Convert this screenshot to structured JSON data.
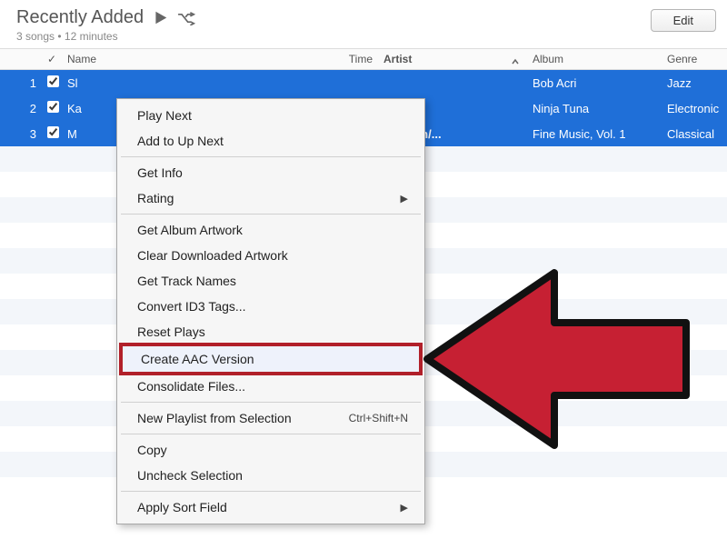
{
  "header": {
    "title": "Recently Added",
    "subtitle": "3 songs • 12 minutes",
    "edit_label": "Edit"
  },
  "columns": {
    "check": "✓",
    "name": "Name",
    "time": "Time",
    "artist": "Artist",
    "album": "Album",
    "genre": "Genre"
  },
  "rows": [
    {
      "num": "1",
      "checked": true,
      "name": "Sl",
      "time": "",
      "artist": "",
      "album": "Bob Acri",
      "genre": "Jazz",
      "selected": true
    },
    {
      "num": "2",
      "checked": true,
      "name": "Ka",
      "time": "",
      "artist": "",
      "album": "Ninja Tuna",
      "genre": "Electronic",
      "selected": true
    },
    {
      "num": "3",
      "checked": true,
      "name": "M",
      "time": "",
      "artist": "oltzman/...",
      "album": "Fine Music, Vol. 1",
      "genre": "Classical",
      "selected": true
    }
  ],
  "menu": {
    "play_next": "Play Next",
    "add_up_next": "Add to Up Next",
    "get_info": "Get Info",
    "rating": "Rating",
    "get_artwork": "Get Album Artwork",
    "clear_artwork": "Clear Downloaded Artwork",
    "get_track_names": "Get Track Names",
    "convert_id3": "Convert ID3 Tags...",
    "reset_plays": "Reset Plays",
    "create_aac": "Create AAC Version",
    "consolidate": "Consolidate Files...",
    "new_playlist": "New Playlist from Selection",
    "new_playlist_shortcut": "Ctrl+Shift+N",
    "copy": "Copy",
    "uncheck": "Uncheck Selection",
    "apply_sort": "Apply Sort Field"
  }
}
